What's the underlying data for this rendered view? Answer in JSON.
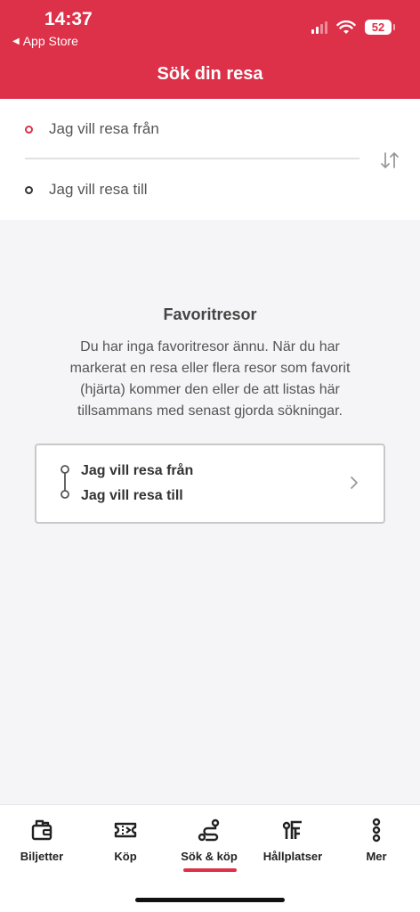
{
  "status": {
    "time": "14:37",
    "back_label": "App Store",
    "battery": "52"
  },
  "header": {
    "title": "Sök din resa"
  },
  "search": {
    "from_placeholder": "Jag vill resa från",
    "to_placeholder": "Jag vill resa till"
  },
  "favorites": {
    "title": "Favoritresor",
    "description": "Du har inga favoritresor ännu. När du har markerat en resa eller flera resor som favorit (hjärta) kommer den eller de att listas här tillsammans med senast gjorda sökningar.",
    "card_from": "Jag vill resa från",
    "card_to": "Jag vill resa till"
  },
  "tabs": [
    {
      "label": "Biljetter",
      "icon": "wallet-icon"
    },
    {
      "label": "Köp",
      "icon": "ticket-icon"
    },
    {
      "label": "Sök & köp",
      "icon": "route-icon"
    },
    {
      "label": "Hållplatser",
      "icon": "stop-icon"
    },
    {
      "label": "Mer",
      "icon": "more-icon"
    }
  ],
  "active_tab": "Sök & köp",
  "colors": {
    "accent": "#dd3049"
  }
}
